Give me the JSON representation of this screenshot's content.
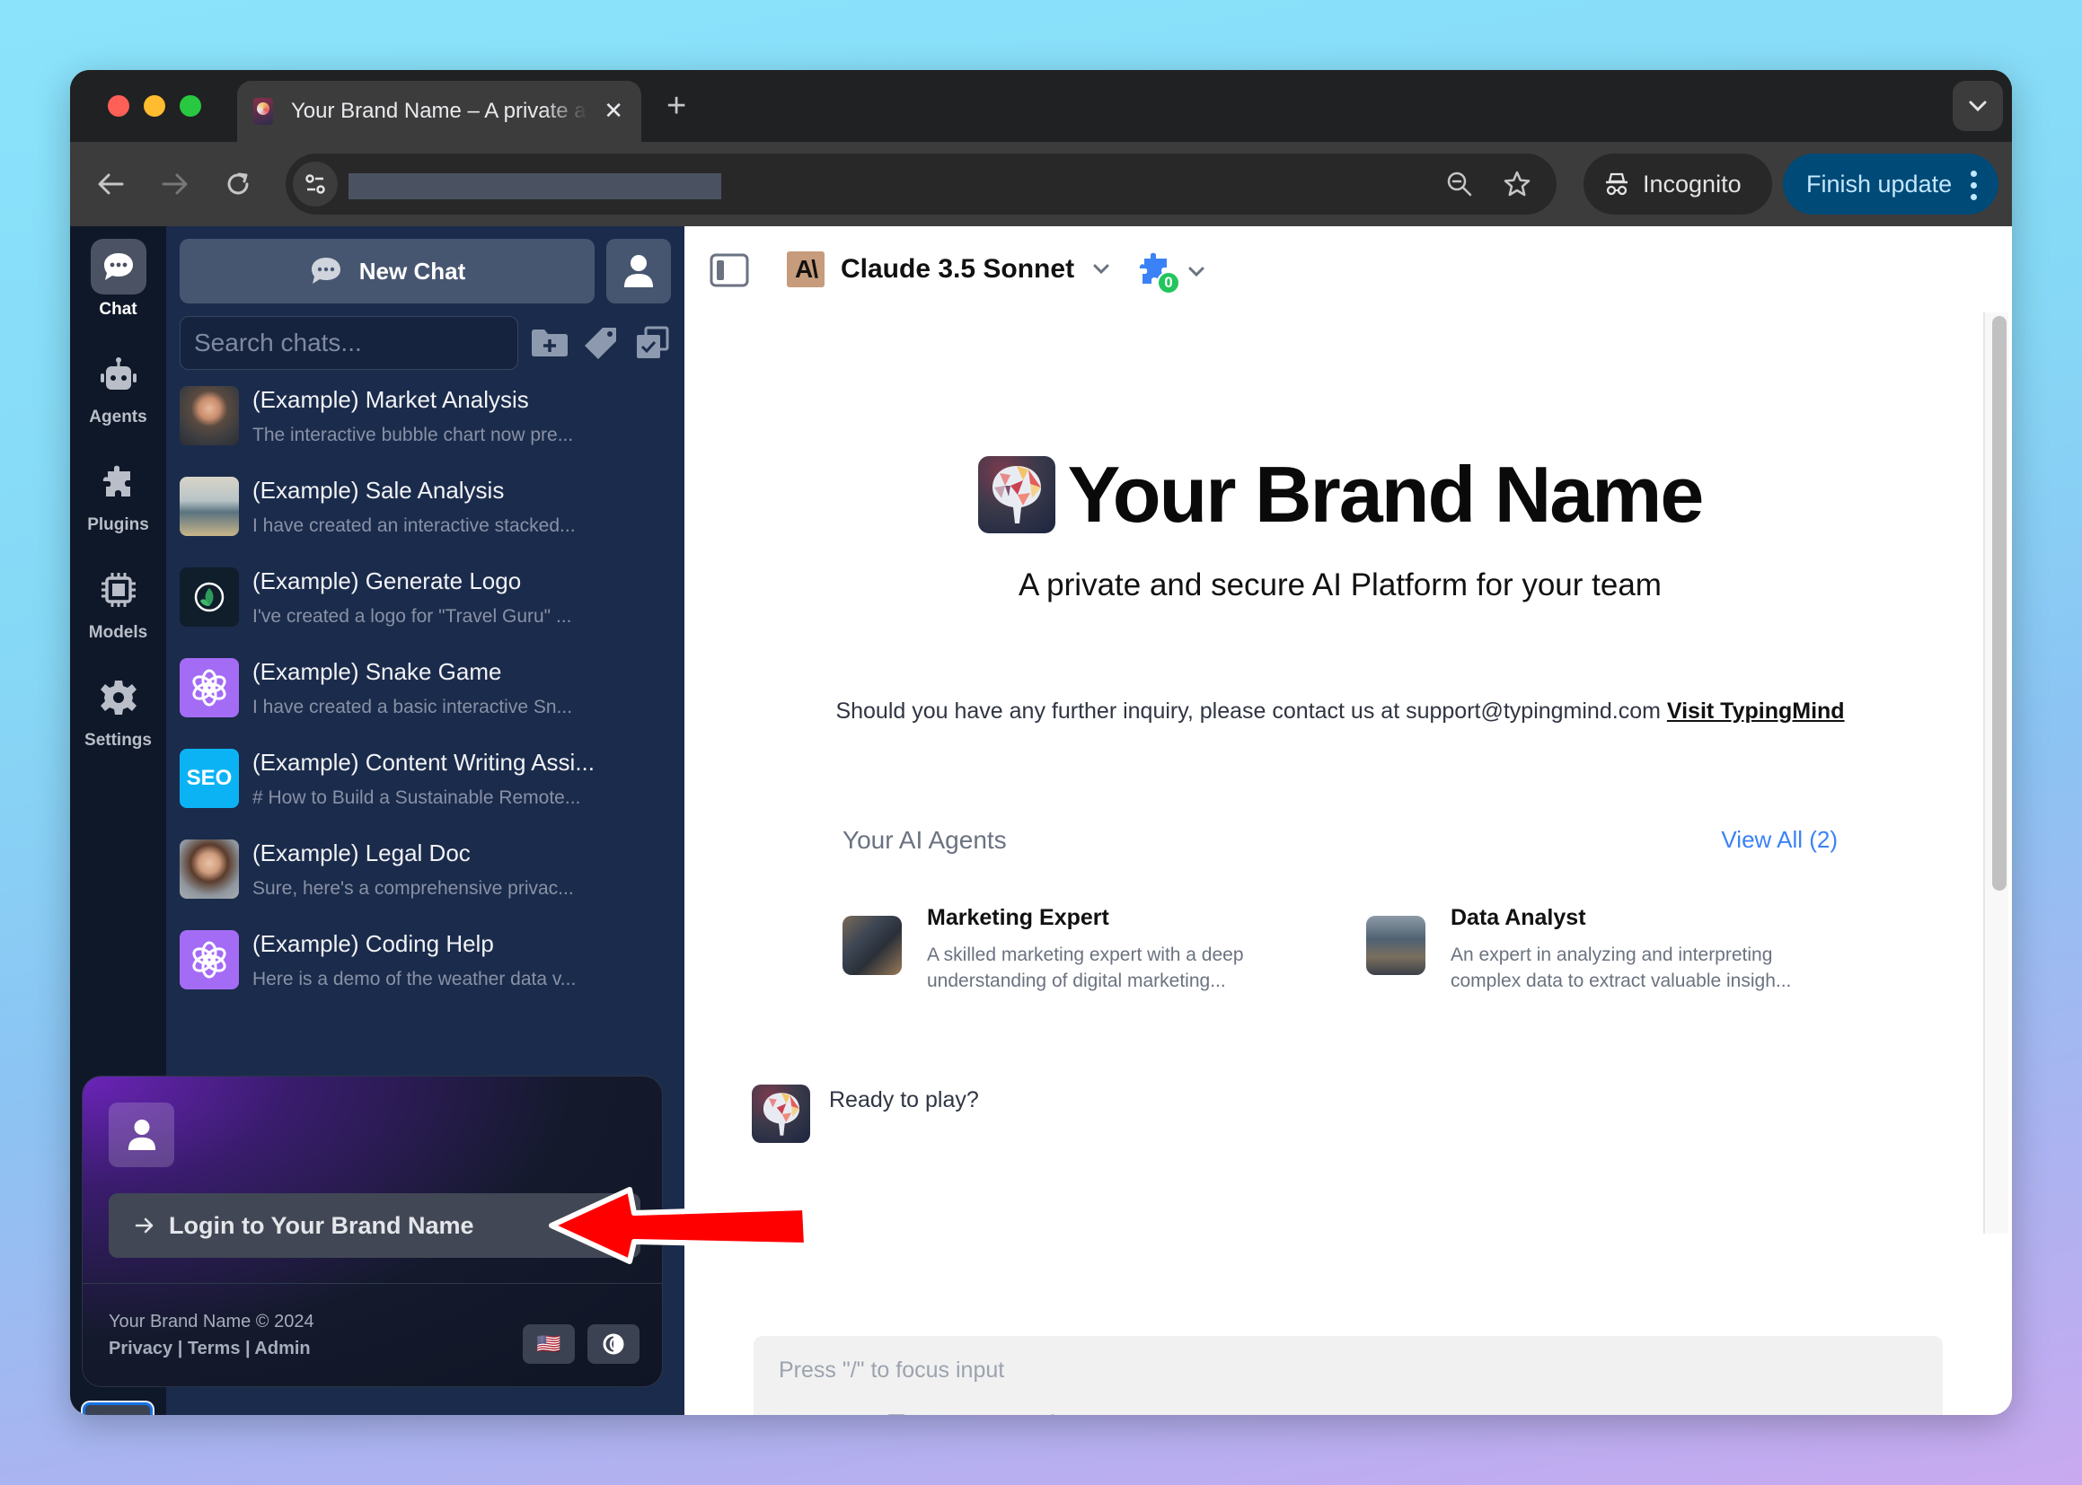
{
  "browser": {
    "tab_title": "Your Brand Name – A private and secure AI Platform for your team",
    "incognito_label": "Incognito",
    "update_label": "Finish update"
  },
  "rail": {
    "items": [
      {
        "label": "Chat",
        "icon": "chat-bubble-icon",
        "active": true
      },
      {
        "label": "Agents",
        "icon": "robot-icon"
      },
      {
        "label": "Plugins",
        "icon": "puzzle-icon"
      },
      {
        "label": "Models",
        "icon": "chip-icon"
      },
      {
        "label": "Settings",
        "icon": "gear-icon"
      }
    ]
  },
  "sidebar": {
    "new_chat_label": "New Chat",
    "search_placeholder": "Search chats...",
    "chats": [
      {
        "title": "(Example) Market Analysis",
        "preview": "The interactive bubble chart now pre...",
        "avatar": "man-photo"
      },
      {
        "title": "(Example) Sale Analysis",
        "preview": "I have created an interactive stacked...",
        "avatar": "office-photo"
      },
      {
        "title": "(Example) Generate Logo",
        "preview": "I've created a logo for \"Travel Guru\" ...",
        "avatar": "leaf-logo"
      },
      {
        "title": "(Example) Snake Game",
        "preview": "I have created a basic interactive Sn...",
        "avatar": "openai-logo"
      },
      {
        "title": "(Example) Content Writing Assi...",
        "preview": "# How to Build a Sustainable Remote...",
        "avatar": "seo-badge",
        "avatar_text": "SEO"
      },
      {
        "title": "(Example) Legal Doc",
        "preview": "Sure, here's a comprehensive privac...",
        "avatar": "woman-photo"
      },
      {
        "title": "(Example) Coding Help",
        "preview": "Here is a demo of the weather data v...",
        "avatar": "openai-logo"
      }
    ],
    "login": {
      "button_label": "Login to Your Brand Name",
      "copyright": "Your Brand Name © 2024",
      "links": [
        "Privacy",
        "Terms",
        "Admin"
      ],
      "link_separator": " | ",
      "language_flag": "🇺🇸"
    }
  },
  "main": {
    "model_name": "Claude 3.5 Sonnet",
    "model_logo_text": "A\\",
    "plugin_count": "0",
    "brand_title": "Your Brand Name",
    "tagline": "A private and secure AI Platform for your team",
    "contact_text": "Should you have any further inquiry, please contact us at support@typingmind.com",
    "contact_link": "Visit TypingMind",
    "agents_heading": "Your AI Agents",
    "view_all_label": "View All (2)",
    "agents": [
      {
        "name": "Marketing Expert",
        "description": "A skilled marketing expert with a deep understanding of digital marketing..."
      },
      {
        "name": "Data Analyst",
        "description": "An expert in analyzing and interpreting complex data to extract valuable insigh..."
      }
    ],
    "welcome_message": "Ready to play?",
    "composer_placeholder": "Press \"/\" to focus input"
  },
  "colors": {
    "sidebar_bg": "#1b2b4b",
    "rail_bg": "#0f1828",
    "accent_blue": "#3b82f6",
    "update_button": "#004a77",
    "annotation_arrow": "#ff0000",
    "plugin_badge": "#22c55e"
  }
}
